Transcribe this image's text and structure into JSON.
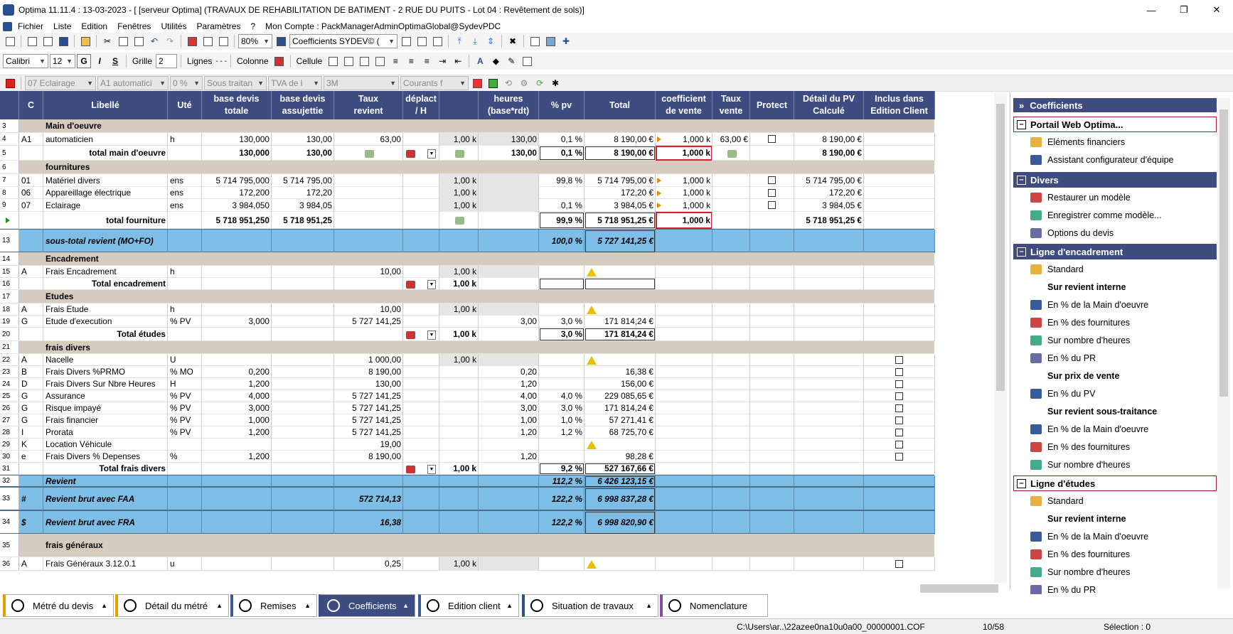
{
  "window": {
    "title": "Optima 11.11.4 : 13-03-2023 - [ [serveur Optima] (TRAVAUX DE REHABILITATION DE BATIMENT - 2 RUE DU PUITS - Lot 04 : Revêtement de sols)]"
  },
  "menu": [
    "Fichier",
    "Liste",
    "Edition",
    "Fenêtres",
    "Utilités",
    "Paramètres",
    "?",
    "Mon Compte : PackManagerAdminOptimaGlobal@SydevPDC"
  ],
  "toolbar1": {
    "zoom": "80%",
    "coef_select": "Coefficients  SYDEV© ("
  },
  "toolbar2": {
    "font": "Calibri",
    "size": "12",
    "bold": "G",
    "italic": "I",
    "strike": "S",
    "grille": "Grille",
    "grille_val": "2",
    "lignes": "Lignes",
    "colonne": "Colonne",
    "cellule": "Cellule"
  },
  "toolbar3": {
    "s1": "07  Eclairage",
    "s2": "A1  automatici",
    "s3": "0 %",
    "s4": "Sous traitan",
    "s5": "TVA de l",
    "s6": "3M",
    "s7": "Courants f"
  },
  "columns": [
    "C",
    "Libellé",
    "Uté",
    "base devis\ntotale",
    "base devis\nassujettie",
    "Taux\nrevient",
    "déplact\n/ H",
    "",
    "heures\n(base*rdt)",
    "% pv",
    "Total",
    "coefficient\nde vente",
    "Taux\nvente",
    "Protect",
    "Détail du PV\nCalculé",
    "Inclus dans\nEdition Client"
  ],
  "rows": [
    {
      "n": "3",
      "type": "sect",
      "lib": "Main d'oeuvre"
    },
    {
      "n": "4",
      "c": "A1",
      "lib": " automaticien",
      "ute": "h",
      "bdt": "130,000",
      "bda": "130,00",
      "tr": "63,00",
      "rdt": "1,00 k",
      "hrs": "130,00",
      "pv": "0,1 %",
      "tot": "8 190,00 €",
      "coef": "1,000 k",
      "tv": "63,00 €",
      "prot": true,
      "det": "8 190,00 €"
    },
    {
      "n": "5",
      "type": "total",
      "lib": "total main d'oeuvre",
      "bdt": "130,000",
      "bda": "130,00",
      "hrs": "130,00",
      "pv": "0,1 %",
      "tot": "8 190,00 €",
      "coef": "1,000 k",
      "det": "8 190,00 €"
    },
    {
      "n": "6",
      "type": "sect",
      "lib": "fournitures"
    },
    {
      "n": "7",
      "c": "01",
      "lib": " Matériel divers",
      "ute": "ens",
      "bdt": "5 714 795,000",
      "bda": "5 714 795,00",
      "rdt": "1,00 k",
      "pv": "99,8 %",
      "tot": "5 714 795,00 €",
      "coef": "1,000 k",
      "prot": true,
      "det": "5 714 795,00 €"
    },
    {
      "n": "8",
      "c": "06",
      "lib": " Appareillage électrique",
      "ute": "ens",
      "bdt": "172,200",
      "bda": "172,20",
      "rdt": "1,00 k",
      "tot": "172,20 €",
      "coef": "1,000 k",
      "prot": true,
      "det": "172,20 €"
    },
    {
      "n": "9",
      "c": "07",
      "lib": " Eclairage",
      "ute": "ens",
      "bdt": "3 984,050",
      "bda": "3 984,05",
      "rdt": "1,00 k",
      "pv": "0,1 %",
      "tot": "3 984,05 €",
      "coef": "1,000 k",
      "prot": true,
      "det": "3 984,05 €"
    },
    {
      "n": "",
      "type": "total",
      "lib": "total fourniture",
      "bdt": "5 718 951,250",
      "bda": "5 718 951,25",
      "pv": "99,9 %",
      "tot": "5 718 951,25 €",
      "coef": "1,000 k",
      "det": "5 718 951,25 €"
    },
    {
      "n": "13",
      "type": "blue",
      "lib": "sous-total revient (MO+FO)",
      "pv": "100,0 %",
      "tot": "5 727 141,25 €"
    },
    {
      "n": "14",
      "type": "sect",
      "lib": "Encadrement"
    },
    {
      "n": "15",
      "c": "A",
      "lib": "Frais Encadrement",
      "ute": "h",
      "tr": "10,00",
      "rdt": "1,00 k",
      "warn": true
    },
    {
      "n": "16",
      "type": "total",
      "lib": "Total encadrement",
      "rdt": "1,00 k"
    },
    {
      "n": "17",
      "type": "sect",
      "lib": "Etudes"
    },
    {
      "n": "18",
      "c": "A",
      "lib": "Frais Etude",
      "ute": "h",
      "tr": "10,00",
      "rdt": "1,00 k",
      "warn": true
    },
    {
      "n": "19",
      "c": "G",
      "lib": "Etude d'execution",
      "ute": "% PV",
      "bdt": "3,000",
      "tr": "5 727 141,25",
      "hrs": "3,00",
      "pv": "3,0 %",
      "tot": "171 814,24 €"
    },
    {
      "n": "20",
      "type": "total",
      "lib": "Total études",
      "rdt": "1,00 k",
      "pv": "3,0 %",
      "tot": "171 814,24 €"
    },
    {
      "n": "21",
      "type": "sect",
      "lib": "frais divers"
    },
    {
      "n": "22",
      "c": "A",
      "lib": "Nacelle",
      "ute": "U",
      "tr": "1 000,00",
      "rdt": "1,00 k",
      "warn": true,
      "incl": true
    },
    {
      "n": "23",
      "c": "B",
      "lib": "Frais Divers %PRMO",
      "ute": "% MO",
      "bdt": "0,200",
      "tr": "8 190,00",
      "hrs": "0,20",
      "tot": "16,38 €",
      "incl": true
    },
    {
      "n": "24",
      "c": "D",
      "lib": "Frais Divers Sur Nbre Heures",
      "ute": "H",
      "bdt": "1,200",
      "tr": "130,00",
      "hrs": "1,20",
      "tot": "156,00 €",
      "incl": true
    },
    {
      "n": "25",
      "c": "G",
      "lib": "Assurance",
      "ute": "% PV",
      "bdt": "4,000",
      "tr": "5 727 141,25",
      "hrs": "4,00",
      "pv": "4,0 %",
      "tot": "229 085,65 €",
      "incl": true
    },
    {
      "n": "26",
      "c": "G",
      "lib": "Risque impayé",
      "ute": "% PV",
      "bdt": "3,000",
      "tr": "5 727 141,25",
      "hrs": "3,00",
      "pv": "3,0 %",
      "tot": "171 814,24 €",
      "incl": true
    },
    {
      "n": "27",
      "c": "G",
      "lib": "Frais financier",
      "ute": "% PV",
      "bdt": "1,000",
      "tr": "5 727 141,25",
      "hrs": "1,00",
      "pv": "1,0 %",
      "tot": "57 271,41 €",
      "incl": true
    },
    {
      "n": "28",
      "c": "I",
      "lib": "Prorata",
      "ute": "% PV",
      "bdt": "1,200",
      "tr": "5 727 141,25",
      "hrs": "1,20",
      "pv": "1,2 %",
      "tot": "68 725,70 €",
      "incl": true
    },
    {
      "n": "29",
      "c": "K",
      "lib": "Location Véhicule",
      "tr": "19,00",
      "warn": true,
      "incl": true
    },
    {
      "n": "30",
      "c": "e",
      "lib": "Frais Divers % Depenses",
      "ute": "%",
      "bdt": "1,200",
      "tr": "8 190,00",
      "hrs": "1,20",
      "tot": "98,28 €",
      "incl": true
    },
    {
      "n": "31",
      "type": "total",
      "lib": "Total frais divers",
      "rdt": "1,00 k",
      "pv": "9,2 %",
      "tot": "527 167,66 €"
    },
    {
      "n": "32",
      "type": "blue",
      "lib": "Revient",
      "pv": "112,2 %",
      "tot": "6 426 123,15 €"
    },
    {
      "n": "33",
      "type": "blue",
      "c": "#",
      "lib": "Revient brut avec FAA",
      "tr": "572 714,13",
      "pv": "122,2 %",
      "tot": "6 998 837,28 €"
    },
    {
      "n": "34",
      "type": "blue",
      "c": "$",
      "lib": "Revient brut avec FRA",
      "tr": "16,38",
      "pv": "122,2 %",
      "tot": "6 998 820,90 €"
    },
    {
      "n": "35",
      "type": "sect",
      "lib": "frais généraux"
    },
    {
      "n": "36",
      "c": "A",
      "lib": "Frais Généraux 3.12.0.1",
      "ute": "u",
      "tr": "0,25",
      "rdt": "1,00 k",
      "warn": true,
      "incl": true
    }
  ],
  "panel": {
    "title": "Coefficients",
    "g1": "Portail Web Optima...",
    "g1_items": [
      "Eléments financiers",
      "Assistant configurateur d'équipe"
    ],
    "g2": "Divers",
    "g2_items": [
      "Restaurer un modèle",
      "Enregistrer comme modèle...",
      "Options du devis"
    ],
    "g3": "Ligne d'encadrement",
    "g3_items": [
      "Standard"
    ],
    "g3_h1": "Sur revient interne",
    "g3_a": [
      "En % de la Main d'oeuvre",
      "En % des fournitures",
      "Sur nombre d'heures",
      "En % du PR"
    ],
    "g3_h2": "Sur prix de vente",
    "g3_b": [
      "En % du PV"
    ],
    "g3_h3": "Sur revient sous-traitance",
    "g3_c": [
      "En % de la Main d'oeuvre",
      "En % des fournitures",
      "Sur nombre d'heures"
    ],
    "g4": "Ligne d'études",
    "g4_items": [
      "Standard"
    ],
    "g4_h1": "Sur revient interne",
    "g4_a": [
      "En % de la Main d'oeuvre",
      "En % des fournitures",
      "Sur nombre d'heures",
      "En % du PR"
    ]
  },
  "tabs": [
    "Métré du devis",
    "Détail du métré",
    "Remises",
    "Coefficients",
    "Edition client",
    "Situation de travaux",
    "Nomenclature"
  ],
  "status": {
    "path": "C:\\Users\\ar..\\22azee0na10u0a00_00000001.COF",
    "page": "10/58",
    "selection": "Sélection : 0"
  }
}
